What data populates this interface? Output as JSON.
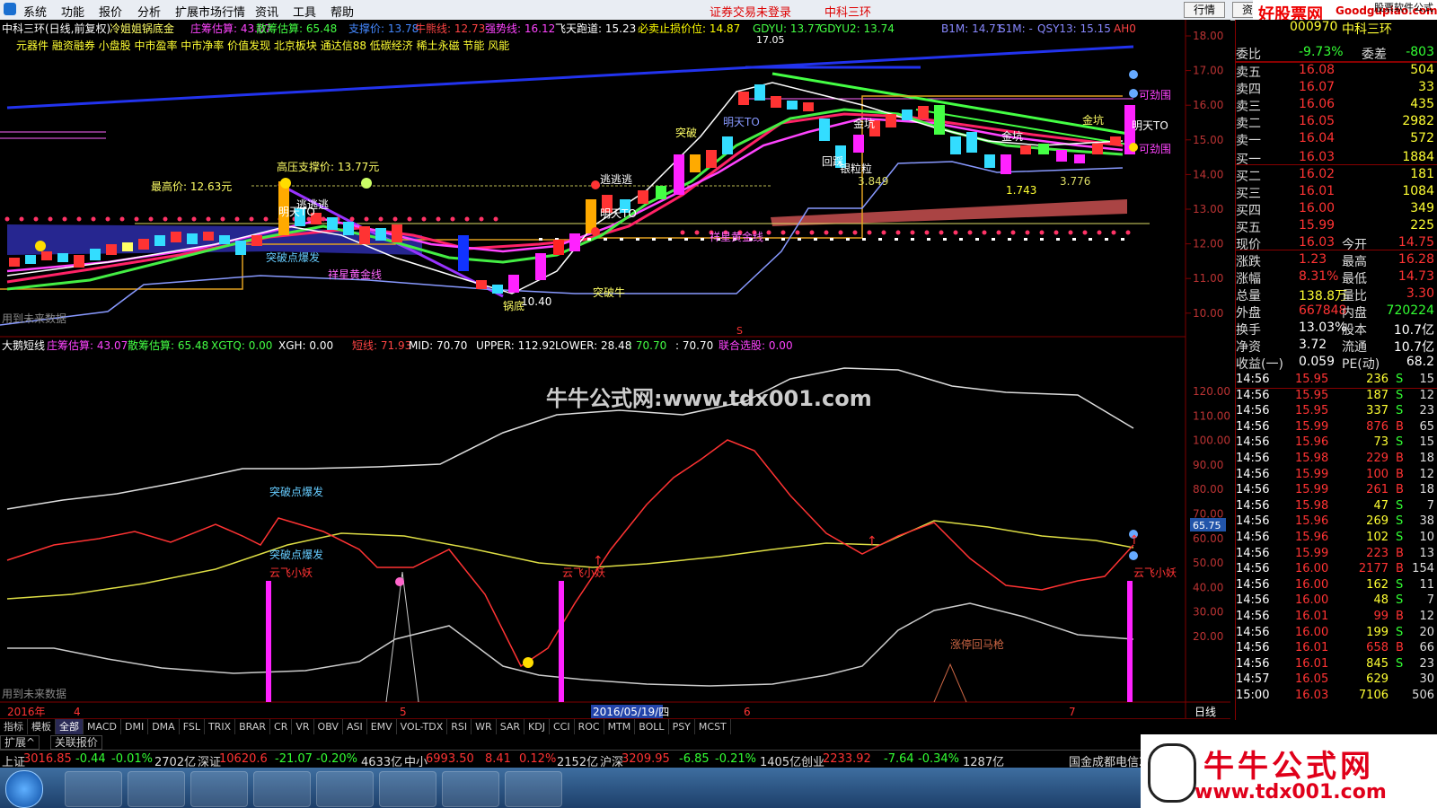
{
  "menu": {
    "items": [
      "系统",
      "功能",
      "报价",
      "分析",
      "扩展市场行情",
      "资讯",
      "工具",
      "帮助"
    ],
    "notice": "证券交易未登录",
    "stock_name": "中科三环",
    "btn_hq": "行情",
    "btn_zi": "资",
    "brand_cn": "好股票网",
    "brand_url": "Goodgupiao.com",
    "brand_sub": "股票软件公式"
  },
  "main_chart": {
    "title": "中科三环(日线,前复权)",
    "indicator": "冷姐姐锅底金",
    "legend": [
      {
        "label": "庄筹估算: 43.07",
        "color": "#ff44ff"
      },
      {
        "label": "散筹估算: 65.48",
        "color": "#44ff44"
      },
      {
        "label": "支撑价: 13.78",
        "color": "#4488ff"
      },
      {
        "label": "牛熊线: 12.73",
        "color": "#ff4444"
      },
      {
        "label": "强势线: 16.12",
        "color": "#ff44ff"
      },
      {
        "label": "飞天跑道: 15.23",
        "color": "#ffffff"
      },
      {
        "label": "必卖止损价位: 14.87",
        "color": "#ffff00"
      },
      {
        "label": "GDYU: 13.77",
        "color": "#44ff44"
      },
      {
        "label": "GDYU2: 13.74",
        "color": "#44ff44"
      },
      {
        "label": "B1M: 14.71",
        "color": "#8888ff"
      },
      {
        "label": "S1M: -",
        "color": "#8888ff"
      },
      {
        "label": "QSY13: 15.15",
        "color": "#8888ff"
      },
      {
        "label": "AH0",
        "color": "#ff4444"
      }
    ],
    "concepts": "元器件 融资融券 小盘股 中市盈率 中市净率 价值发现 北京板块 通达信88 低碳经济 稀土永磁 节能 风能",
    "y_ticks": [
      "18.00",
      "17.00",
      "16.00",
      "15.00",
      "14.00",
      "13.00",
      "12.00",
      "11.00",
      "10.00"
    ],
    "annotations": {
      "high_support": "高压支撑价: 13.77元",
      "highest": "最高价: 12.63元",
      "run1": "逃逃逃",
      "run2": "逃逃逃",
      "breakout": "突破",
      "burst": "突破点爆发",
      "gold1": "祥星黄金线",
      "gold2": "祥星黄金线",
      "bottom": "锅底",
      "low_price": "10.40",
      "break_bull": "突破牛",
      "tomorrow1": "明天TO",
      "tomorrow2": "明天TO",
      "tomorrow3": "明天TO",
      "jinkeng1": "金坑",
      "jinkeng2": "金坑",
      "jinkeng3": "金坑",
      "pullback": "回踩",
      "silver": "银粒粒",
      "v1": "3.849",
      "v2": "1.743",
      "v3": "3.776",
      "buy1": "可劲围",
      "buy2": "可劲围",
      "future": "用到未来数据",
      "s_mark": "S",
      "peak_label": "17.05"
    }
  },
  "sub_chart": {
    "title": "大鹅短线",
    "legend": [
      {
        "label": "庄筹估算: 43.07",
        "color": "#ff44ff"
      },
      {
        "label": "散筹估算: 65.48",
        "color": "#44ff44"
      },
      {
        "label": "XGTQ: 0.00",
        "color": "#44ff44"
      },
      {
        "label": "XGH: 0.00",
        "color": "#ffffff"
      },
      {
        "label": "短线: 71.93",
        "color": "#ff4444"
      },
      {
        "label": "MID: 70.70",
        "color": "#ffffff"
      },
      {
        "label": "UPPER: 112.92",
        "color": "#ffffff"
      },
      {
        "label": "LOWER: 28.48",
        "color": "#ffffff"
      },
      {
        "label": ": 70.70",
        "color": "#44ff44"
      },
      {
        "label": ": 70.70",
        "color": "#ffffff"
      },
      {
        "label": "联合选股: 0.00",
        "color": "#ff44ff"
      }
    ],
    "watermark": "牛牛公式网:www.tdx001.com",
    "y_ticks": [
      "120.00",
      "110.00",
      "100.00",
      "90.00",
      "80.00",
      "70.00",
      "60.00",
      "50.00",
      "40.00",
      "30.00",
      "20.00"
    ],
    "current_value": "65.75",
    "annotations": {
      "burst1": "突破点爆发",
      "burst2": "突破点爆发",
      "fly1": "云飞小妖",
      "fly2": "云飞小妖",
      "fly3": "云飞小妖",
      "limit": "涨停回马枪",
      "future": "用到未来数据"
    }
  },
  "time_axis": {
    "year": "2016年",
    "labels": [
      "4",
      "5",
      "6",
      "7"
    ],
    "cursor_date": "2016/05/19/四",
    "period": "日线"
  },
  "indicator_tabs": [
    "指标",
    "模板",
    "全部",
    "MACD",
    "DMI",
    "DMA",
    "FSL",
    "TRIX",
    "BRAR",
    "CR",
    "VR",
    "OBV",
    "ASI",
    "EMV",
    "VOL-TDX",
    "RSI",
    "WR",
    "SAR",
    "KDJ",
    "CCI",
    "ROC",
    "MTM",
    "BOLL",
    "PSY",
    "MCST"
  ],
  "indicator_tab_selected": "全部",
  "ext_tabs": [
    "扩展^",
    "关联报价"
  ],
  "scroll_ctrl": [
    "+",
    "-",
    "0"
  ],
  "quote": {
    "code": "000970",
    "name": "中科三环",
    "wei_bi": {
      "label": "委比",
      "value": "-9.73%",
      "label2": "委差",
      "value2": "-803"
    },
    "asks": [
      {
        "label": "卖五",
        "price": "16.08",
        "vol": "504"
      },
      {
        "label": "卖四",
        "price": "16.07",
        "vol": "33"
      },
      {
        "label": "卖三",
        "price": "16.06",
        "vol": "435"
      },
      {
        "label": "卖二",
        "price": "16.05",
        "vol": "2982"
      },
      {
        "label": "卖一",
        "price": "16.04",
        "vol": "572"
      }
    ],
    "bids": [
      {
        "label": "买一",
        "price": "16.03",
        "vol": "1884"
      },
      {
        "label": "买二",
        "price": "16.02",
        "vol": "181"
      },
      {
        "label": "买三",
        "price": "16.01",
        "vol": "1084"
      },
      {
        "label": "买四",
        "price": "16.00",
        "vol": "349"
      },
      {
        "label": "买五",
        "price": "15.99",
        "vol": "225"
      }
    ],
    "stats": [
      {
        "l1": "现价",
        "v1": "16.03",
        "l2": "今开",
        "v2": "14.75",
        "c1": "#ff3333",
        "c2": "#ff3333"
      },
      {
        "l1": "涨跌",
        "v1": "1.23",
        "l2": "最高",
        "v2": "16.28",
        "c1": "#ff3333",
        "c2": "#ff3333"
      },
      {
        "l1": "涨幅",
        "v1": "8.31%",
        "l2": "最低",
        "v2": "14.73",
        "c1": "#ff3333",
        "c2": "#ff3333"
      },
      {
        "l1": "总量",
        "v1": "138.8万",
        "l2": "量比",
        "v2": "3.30",
        "c1": "#ffff33",
        "c2": "#ff3333"
      },
      {
        "l1": "外盘",
        "v1": "667848",
        "l2": "内盘",
        "v2": "720224",
        "c1": "#ff3333",
        "c2": "#33ff33"
      },
      {
        "l1": "换手",
        "v1": "13.03%",
        "l2": "股本",
        "v2": "10.7亿",
        "c1": "#ffffff",
        "c2": "#ffffff"
      },
      {
        "l1": "净资",
        "v1": "3.72",
        "l2": "流通",
        "v2": "10.7亿",
        "c1": "#ffffff",
        "c2": "#ffffff"
      },
      {
        "l1": "收益(一)",
        "v1": "0.059",
        "l2": "PE(动)",
        "v2": "68.2",
        "c1": "#ffffff",
        "c2": "#ffffff"
      }
    ],
    "ticks": [
      {
        "t": "14:56",
        "p": "15.95",
        "v": "236",
        "d": "S",
        "n": "15"
      },
      {
        "t": "14:56",
        "p": "15.95",
        "v": "187",
        "d": "S",
        "n": "12"
      },
      {
        "t": "14:56",
        "p": "15.95",
        "v": "337",
        "d": "S",
        "n": "23"
      },
      {
        "t": "14:56",
        "p": "15.99",
        "v": "876",
        "d": "B",
        "n": "65"
      },
      {
        "t": "14:56",
        "p": "15.96",
        "v": "73",
        "d": "S",
        "n": "15"
      },
      {
        "t": "14:56",
        "p": "15.98",
        "v": "229",
        "d": "B",
        "n": "18"
      },
      {
        "t": "14:56",
        "p": "15.99",
        "v": "100",
        "d": "B",
        "n": "12"
      },
      {
        "t": "14:56",
        "p": "15.99",
        "v": "261",
        "d": "B",
        "n": "18"
      },
      {
        "t": "14:56",
        "p": "15.98",
        "v": "47",
        "d": "S",
        "n": "7"
      },
      {
        "t": "14:56",
        "p": "15.96",
        "v": "269",
        "d": "S",
        "n": "38"
      },
      {
        "t": "14:56",
        "p": "15.96",
        "v": "102",
        "d": "S",
        "n": "10"
      },
      {
        "t": "14:56",
        "p": "15.99",
        "v": "223",
        "d": "B",
        "n": "13"
      },
      {
        "t": "14:56",
        "p": "16.00",
        "v": "2177",
        "d": "B",
        "n": "154"
      },
      {
        "t": "14:56",
        "p": "16.00",
        "v": "162",
        "d": "S",
        "n": "11"
      },
      {
        "t": "14:56",
        "p": "16.00",
        "v": "48",
        "d": "S",
        "n": "7"
      },
      {
        "t": "14:56",
        "p": "16.01",
        "v": "99",
        "d": "B",
        "n": "12"
      },
      {
        "t": "14:56",
        "p": "16.00",
        "v": "199",
        "d": "S",
        "n": "20"
      },
      {
        "t": "14:56",
        "p": "16.01",
        "v": "658",
        "d": "B",
        "n": "66"
      },
      {
        "t": "14:56",
        "p": "16.01",
        "v": "845",
        "d": "S",
        "n": "23"
      },
      {
        "t": "14:57",
        "p": "16.05",
        "v": "629",
        "d": "",
        "n": "30"
      },
      {
        "t": "15:00",
        "p": "16.03",
        "v": "7106",
        "d": "",
        "n": "506"
      }
    ]
  },
  "status": {
    "sh": {
      "name": "上证",
      "val": "3016.85",
      "chg": "-0.44",
      "pct": "-0.01%",
      "amt": "2702亿"
    },
    "sz": {
      "name": "深证",
      "val": "10620.6",
      "chg": "-21.07",
      "pct": "-0.20%",
      "amt": "4633亿"
    },
    "zx": {
      "name": "中小",
      "val": "6993.50",
      "chg": "8.41",
      "pct": "0.12%",
      "amt": "2152亿"
    },
    "hs": {
      "name": "沪深",
      "val": "3209.95",
      "chg": "-6.85",
      "pct": "-0.21%",
      "amt": "1405亿"
    },
    "cy": {
      "name": "创业",
      "val": "2233.92",
      "chg": "-7.64",
      "pct": "-0.34%",
      "amt": "1287亿"
    },
    "broker": "国金成都电信2"
  },
  "watermark_brand": {
    "title": "牛牛公式网",
    "url": "www.tdx001.com"
  },
  "colors": {
    "up": "#ff3333",
    "down": "#33ff33",
    "panel_border": "#800000",
    "accent": "#1a6fd0"
  }
}
